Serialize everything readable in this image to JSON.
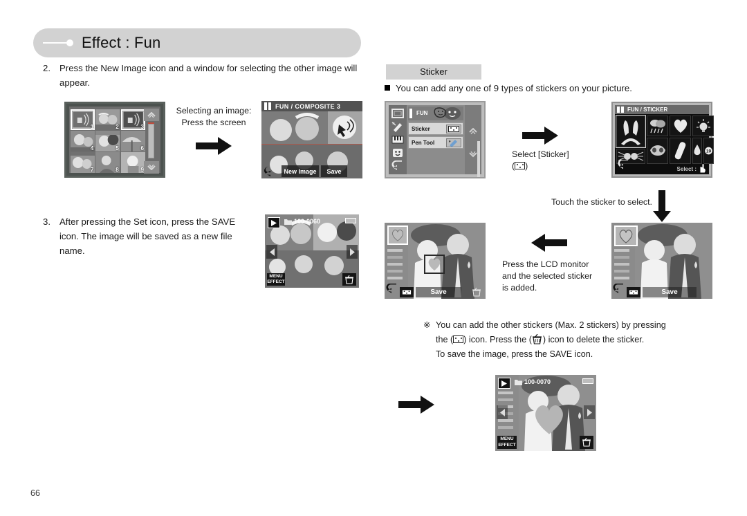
{
  "header": {
    "title": "Effect : Fun"
  },
  "page_number": "66",
  "steps": {
    "step2": {
      "num": "2.",
      "text": "Press the New Image icon and a window for selecting the other image will appear."
    },
    "step3": {
      "num": "3.",
      "text": "After pressing the Set icon, press the SAVE icon. The image will be saved as a new file name."
    }
  },
  "sticker_section": {
    "box_label": "Sticker",
    "bullet_text": "You can add any one of 9 types of stickers on your picture."
  },
  "captions": {
    "selecting_image": "Selecting an image:",
    "press_the_screen": "Press the screen",
    "select_sticker": "Select [Sticker]",
    "select_sticker_icon": "(      )",
    "touch_sticker": "Touch the sticker to select.",
    "press_lcd": "Press the LCD monitor and the selected sticker is added."
  },
  "note": {
    "mark": "※",
    "line1": "You can add the other stickers (Max. 2 stickers) by pressing",
    "line2_a": "the (",
    "line2_b": ") icon. Press the (",
    "line2_c": ") icon to delete the sticker.",
    "line3": "To save the image, press the SAVE icon."
  },
  "screens": {
    "index": {
      "name": "thumbnail-index",
      "thumb_numbers": [
        "1",
        "2",
        "3",
        "4",
        "5",
        "6",
        "7",
        "8",
        "9"
      ],
      "up_icon": "scroll-up",
      "down_icon": "scroll-down"
    },
    "composite": {
      "title": "FUN / COMPOSITE 3",
      "buttons": {
        "back": "back-arrow",
        "new_image": "New Image",
        "save": "Save"
      }
    },
    "fun_menu": {
      "title": "FUN",
      "rows": [
        {
          "label": "Sticker",
          "icon": "sticker-icon"
        },
        {
          "label": "Pen Tool",
          "icon": "pen-tool-icon"
        }
      ],
      "rail_icons": [
        "crop-icon",
        "brush-icon",
        "piano-icon",
        "face-icon",
        "back-icon"
      ],
      "side_icons": [
        "scroll-up",
        "scroll-down"
      ]
    },
    "sticker_picker": {
      "title": "FUN / STICKER",
      "select_label": "Select :",
      "stickers": [
        "bunny-ears",
        "rain-cloud",
        "heart",
        "light-bulb",
        "whiskers-glasses",
        "mask",
        "bandage",
        "water-drop",
        "number-badge-19"
      ],
      "back_icon": "back-arrow"
    },
    "saved_photo": {
      "file_name": "100-0060",
      "play_icon": "play-icon",
      "menu_label": "MENU",
      "effect_label": "EFFECT",
      "delete_icon": "trash-icon",
      "prev_icon": "prev-arrow",
      "next_icon": "next-arrow"
    },
    "sticker_preview": {
      "save_label": "Save",
      "back_icon": "back-arrow",
      "add_sticker_icon": "sticker-icon",
      "delete_icon": "trash-icon"
    },
    "sticker_selected": {
      "save_label": "Save",
      "back_icon": "back-arrow",
      "add_sticker_icon": "sticker-icon"
    },
    "final_photo": {
      "file_name": "100-0070",
      "play_icon": "play-icon",
      "menu_label": "MENU",
      "effect_label": "EFFECT",
      "delete_icon": "trash-icon",
      "prev_icon": "prev-arrow",
      "next_icon": "next-arrow"
    }
  },
  "colors": {
    "header_pill": "#d2d2d2",
    "section_box": "#d2d2d2",
    "text": "#1a1a1a",
    "lcd_dark": "#0d0d0d"
  }
}
